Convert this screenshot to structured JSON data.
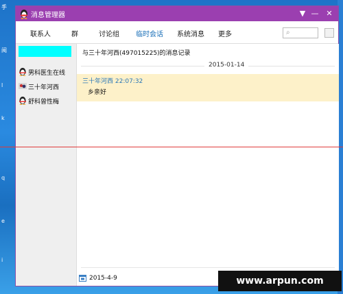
{
  "window": {
    "title": "消息管理器",
    "controls": [
      "▼",
      "—",
      "✕"
    ]
  },
  "toolbar": {
    "tabs": [
      {
        "label": "联系人"
      },
      {
        "label": "群"
      },
      {
        "label": "讨论组"
      },
      {
        "label": "临时会话",
        "active": true
      },
      {
        "label": "系统消息"
      },
      {
        "label": "更多"
      }
    ],
    "search_icon": "search-icon"
  },
  "sidebar": {
    "contacts": [
      {
        "name": ""
      },
      {
        "name": "男科医生在线",
        "icon": "qq-penguin-icon"
      },
      {
        "name": "三十年河西",
        "icon": "qq-user-icon"
      },
      {
        "name": "舒科曾性梅",
        "icon": "qq-penguin-icon"
      }
    ]
  },
  "main": {
    "record_title": "与三十年河西(497015225)的消息记录",
    "date": "2015-01-14",
    "message": {
      "sender_time": "三十年河西 22:07:32",
      "text": "乡亲好"
    },
    "footer_date": "2015-4-9"
  },
  "watermark": {
    "text": "ARPUN",
    "url": "www.arpun.com"
  },
  "desktop": {
    "icon_chars": [
      "手",
      "阅",
      "l",
      "k",
      "q",
      "e",
      "i"
    ]
  },
  "colors": {
    "titlebar": "#9b3fb0",
    "highlight": "#00ffff",
    "message_bg": "#fdf1c9",
    "active_tab": "#1a6fb8",
    "red_line": "#e03a3a"
  }
}
